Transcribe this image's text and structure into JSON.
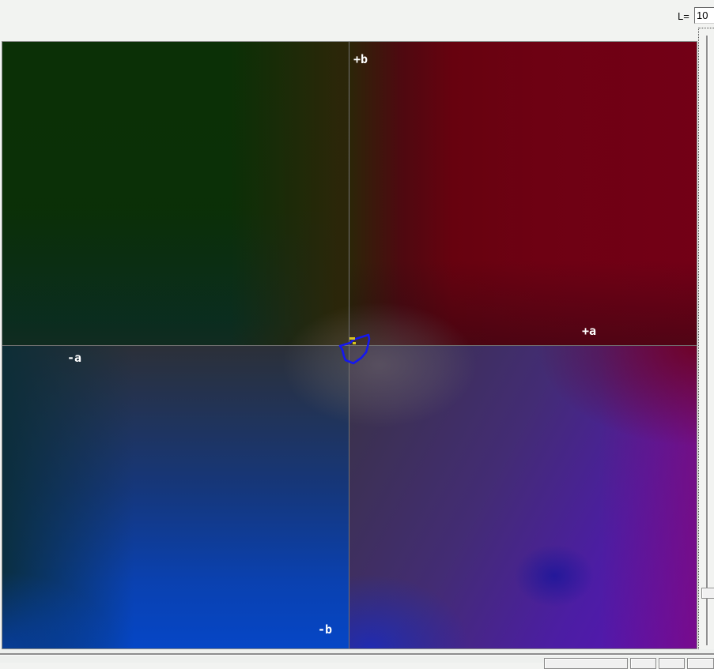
{
  "header": {
    "l_label": "L=",
    "l_value": "10"
  },
  "colorspace": {
    "axis_labels": {
      "up": "+b",
      "down": "-b",
      "right": "+a",
      "left": "-a"
    },
    "axis_line_color": "#737373",
    "quadrant_colors": {
      "top_left_green": "#0b2f06",
      "top_right_red": "#6e0113",
      "bottom_left_blue": "#0546c6",
      "bottom_right_purple": "#5912b8",
      "center_neutral": "#76706f"
    },
    "gamut_outline": {
      "color": "#1518ee",
      "points": [
        [
          41,
          7
        ],
        [
          28,
          11
        ],
        [
          22,
          13
        ],
        [
          18,
          17
        ],
        [
          5,
          21
        ],
        [
          8,
          26
        ],
        [
          10,
          34
        ],
        [
          12,
          39
        ],
        [
          22,
          43
        ],
        [
          32,
          36
        ],
        [
          38,
          29
        ],
        [
          40,
          22
        ],
        [
          42,
          12
        ],
        [
          41,
          7
        ]
      ]
    },
    "marker_color": "#d8c41e"
  }
}
